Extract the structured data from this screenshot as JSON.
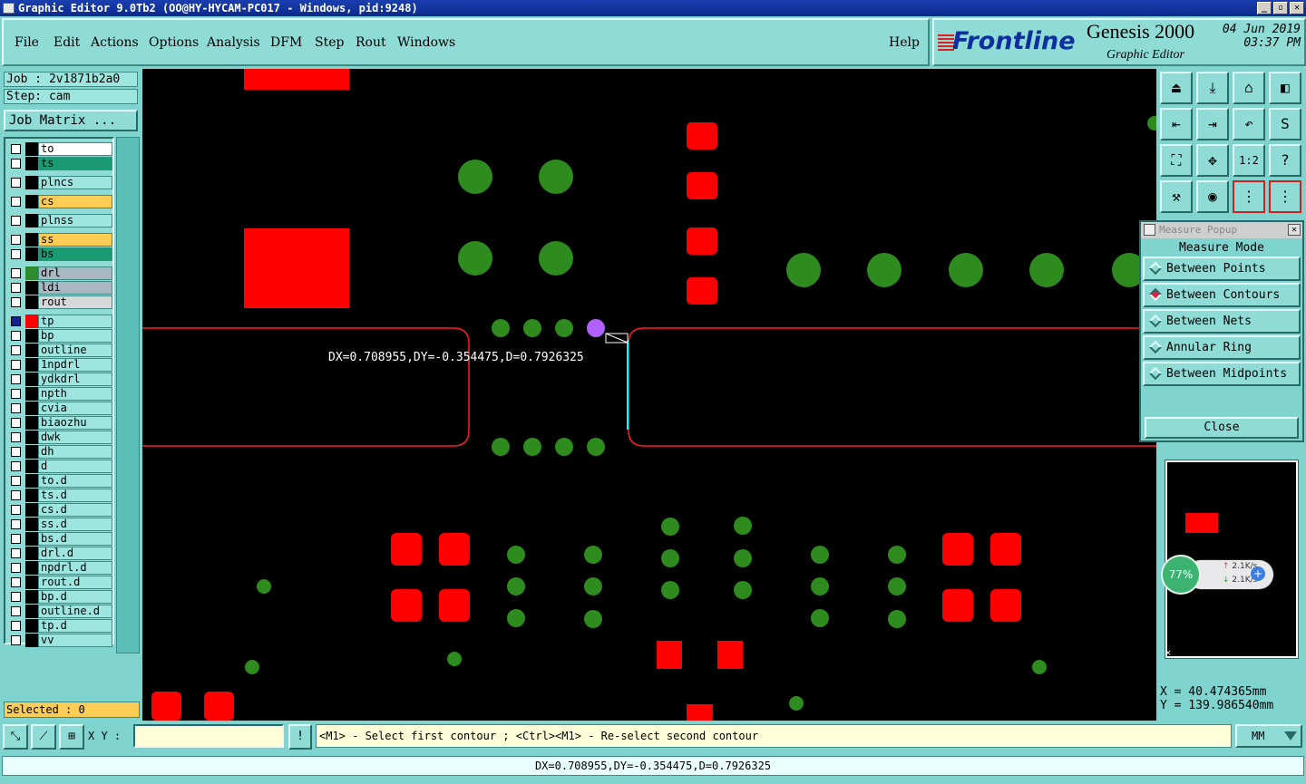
{
  "window": {
    "title": "Graphic Editor 9.0Tb2 (OO@HY-HYCAM-PC017 - Windows, pid:9248)",
    "buttons": [
      "_",
      "▫",
      "✕"
    ]
  },
  "menu": {
    "items": [
      "File",
      "Edit",
      "Actions",
      "Options",
      "Analysis",
      "DFM",
      "Step",
      "Rout",
      "Windows"
    ],
    "help": "Help"
  },
  "brand": {
    "logo": "Frontline",
    "product": "Genesis 2000",
    "subtitle": "Graphic Editor",
    "date": "04 Jun 2019",
    "time": "03:37 PM"
  },
  "job": {
    "job_line": "Job : 2v1871b2a0",
    "step_line": "Step: cam",
    "matrix_button": "Job Matrix ..."
  },
  "layers": [
    {
      "name": "to",
      "color": "#000000",
      "name_bg": "#ffffff",
      "checked": false
    },
    {
      "name": "ts",
      "color": "#000000",
      "name_bg": "#1a9a72",
      "checked": false
    },
    {
      "name": "plncs",
      "color": "#000000",
      "name_bg": "#9fe5df",
      "checked": false
    },
    {
      "name": "cs",
      "color": "#000000",
      "name_bg": "#ffcc55",
      "checked": false
    },
    {
      "name": "plnss",
      "color": "#000000",
      "name_bg": "#9fe5df",
      "checked": false
    },
    {
      "name": "ss",
      "color": "#000000",
      "name_bg": "#ffcc55",
      "checked": false
    },
    {
      "name": "bs",
      "color": "#000000",
      "name_bg": "#1a9a72",
      "checked": false
    },
    {
      "name": "drl",
      "color": "#2e8b2e",
      "name_bg": "#a9b8c0",
      "checked": false
    },
    {
      "name": "ldi",
      "color": "#000000",
      "name_bg": "#a9b8c0",
      "checked": false
    },
    {
      "name": "rout",
      "color": "#000000",
      "name_bg": "#d8d8d8",
      "checked": false
    },
    {
      "name": "tp",
      "color": "#ff0000",
      "name_bg": "#9fe5df",
      "checked": true
    },
    {
      "name": "bp",
      "color": "#000000",
      "name_bg": "#9fe5df",
      "checked": false
    },
    {
      "name": "outline",
      "color": "#000000",
      "name_bg": "#9fe5df",
      "checked": false
    },
    {
      "name": "1npdrl",
      "color": "#000000",
      "name_bg": "#9fe5df",
      "checked": false
    },
    {
      "name": "ydkdrl",
      "color": "#000000",
      "name_bg": "#9fe5df",
      "checked": false
    },
    {
      "name": "npth",
      "color": "#000000",
      "name_bg": "#9fe5df",
      "checked": false
    },
    {
      "name": "cvia",
      "color": "#000000",
      "name_bg": "#9fe5df",
      "checked": false
    },
    {
      "name": "biaozhu",
      "color": "#000000",
      "name_bg": "#9fe5df",
      "checked": false
    },
    {
      "name": "dwk",
      "color": "#000000",
      "name_bg": "#9fe5df",
      "checked": false
    },
    {
      "name": "dh",
      "color": "#000000",
      "name_bg": "#9fe5df",
      "checked": false
    },
    {
      "name": "d",
      "color": "#000000",
      "name_bg": "#9fe5df",
      "checked": false
    },
    {
      "name": "to.d",
      "color": "#000000",
      "name_bg": "#9fe5df",
      "checked": false
    },
    {
      "name": "ts.d",
      "color": "#000000",
      "name_bg": "#9fe5df",
      "checked": false
    },
    {
      "name": "cs.d",
      "color": "#000000",
      "name_bg": "#9fe5df",
      "checked": false
    },
    {
      "name": "ss.d",
      "color": "#000000",
      "name_bg": "#9fe5df",
      "checked": false
    },
    {
      "name": "bs.d",
      "color": "#000000",
      "name_bg": "#9fe5df",
      "checked": false
    },
    {
      "name": "drl.d",
      "color": "#000000",
      "name_bg": "#9fe5df",
      "checked": false
    },
    {
      "name": "npdrl.d",
      "color": "#000000",
      "name_bg": "#9fe5df",
      "checked": false
    },
    {
      "name": "rout.d",
      "color": "#000000",
      "name_bg": "#9fe5df",
      "checked": false
    },
    {
      "name": "bp.d",
      "color": "#000000",
      "name_bg": "#9fe5df",
      "checked": false
    },
    {
      "name": "outline.d",
      "color": "#000000",
      "name_bg": "#9fe5df",
      "checked": false
    },
    {
      "name": "tp.d",
      "color": "#000000",
      "name_bg": "#9fe5df",
      "checked": false
    },
    {
      "name": "vv",
      "color": "#000000",
      "name_bg": "#9fe5df",
      "checked": false
    }
  ],
  "selected": "Selected : 0",
  "canvas": {
    "measure_label": "DX=0.708955,DY=-0.354475,D=0.7926325",
    "colors": {
      "pad": "#ff0000",
      "hole": "#2e8b1e",
      "outline": "#ff2020",
      "measure": "#00ffff",
      "marker": "#b060ff"
    }
  },
  "toolbar": {
    "icons": [
      "home-up-icon",
      "home-down-icon",
      "home-icon",
      "panel-icon",
      "pan-left-icon",
      "pan-right-icon",
      "step-back-icon",
      "s-curve-icon",
      "zoom-fit-icon",
      "zoom-center-icon",
      "scale-one-two-icon",
      "help-icon",
      "tools-icon",
      "record-icon",
      "color-layers-icon",
      "color-layers-alt-icon"
    ],
    "glyphs": [
      "⏏",
      "⤓",
      "⌂",
      "◧",
      "⇤",
      "⇥",
      "↶",
      "S",
      "⛶",
      "✥",
      "1:2",
      "?",
      "⚒",
      "◉",
      "⋮",
      "⋮"
    ]
  },
  "measure_popup": {
    "title": "Measure Popup",
    "mode_label": "Measure Mode",
    "options": [
      "Between Points",
      "Between Contours",
      "Between Nets",
      "Annular Ring",
      "Between Midpoints"
    ],
    "selected_option": "Between Contours",
    "close_label": "Close"
  },
  "netmon": {
    "percent": "77%",
    "up": "2.1K/s",
    "down": "2.1K/s",
    "plus": "+"
  },
  "coords": {
    "x": "X  =  40.474365mm",
    "y": "Y  = 139.986540mm"
  },
  "bottom": {
    "xy_label": "X Y :",
    "xy_value": "",
    "alert": "!",
    "prompt": "<M1> - Select first contour ; <Ctrl><M1> - Re-select second contour",
    "units": "MM"
  },
  "status": "DX=0.708955,DY=-0.354475,D=0.7926325"
}
